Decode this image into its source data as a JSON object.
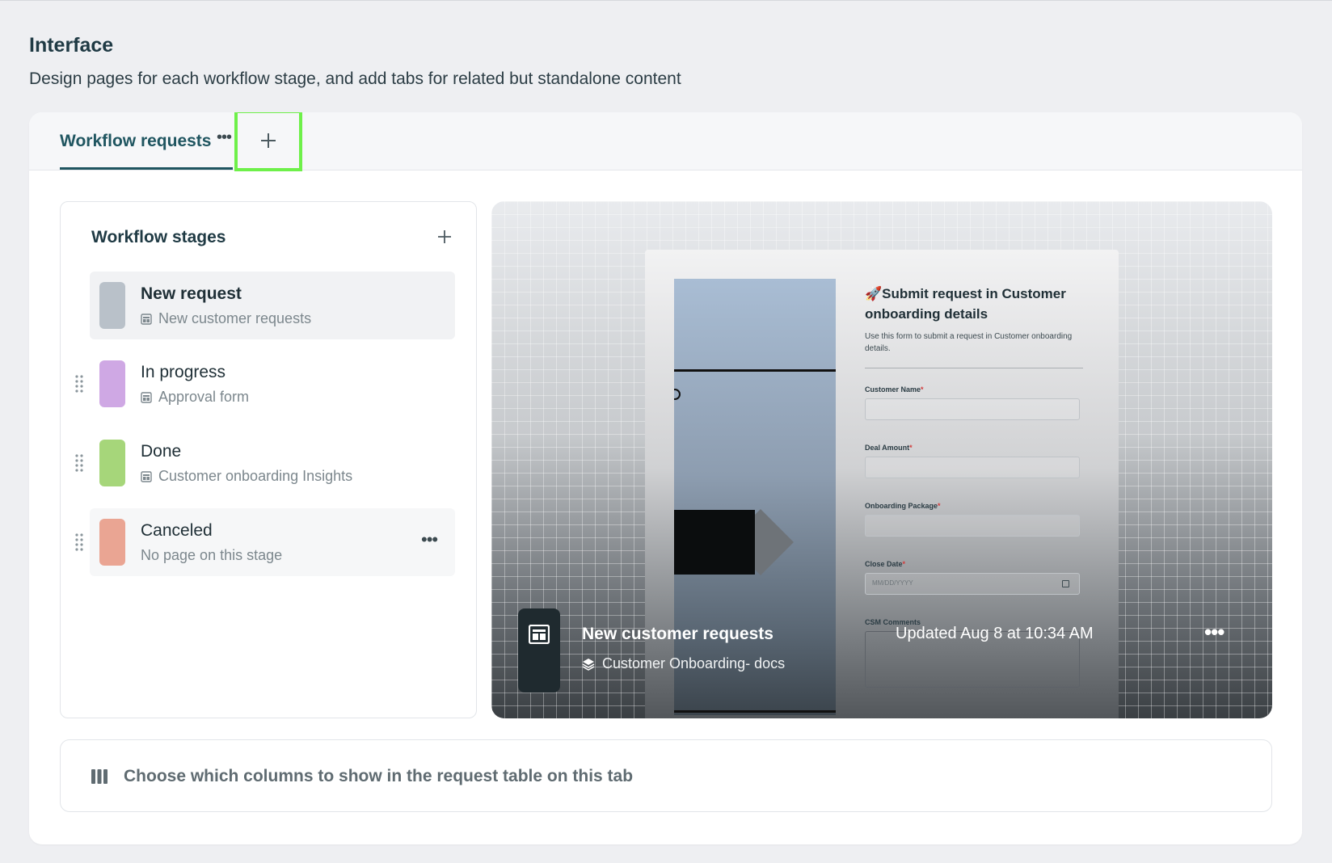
{
  "page": {
    "title": "Interface",
    "subtitle": "Design pages for each workflow stage, and add tabs for related but standalone content"
  },
  "tabs": {
    "items": [
      {
        "label": "Workflow requests",
        "active": true
      }
    ],
    "more_label": "•••",
    "add_icon": "plus-icon"
  },
  "stages": {
    "title": "Workflow stages",
    "add_icon": "plus-icon",
    "items": [
      {
        "name": "New request",
        "page": "New customer requests",
        "color": "#b9c1c9",
        "page_icon": "page-icon"
      },
      {
        "name": "In progress",
        "page": "Approval form",
        "color": "#cfa8e4",
        "page_icon": "page-icon"
      },
      {
        "name": "Done",
        "page": "Customer onboarding Insights",
        "color": "#a6d67a",
        "page_icon": "page-icon"
      },
      {
        "name": "Canceled",
        "page": "No page on this stage",
        "color": "#eaa593"
      }
    ],
    "more_label": "•••"
  },
  "preview": {
    "form_title": "🚀Submit request in Customer onboarding details",
    "form_desc": "Use this form to submit a request in Customer onboarding details.",
    "fields": [
      {
        "label": "Customer Name",
        "required": "*"
      },
      {
        "label": "Deal Amount",
        "required": "*"
      },
      {
        "label": "Onboarding Package",
        "required": "*"
      },
      {
        "label": "Close Date",
        "required": "*",
        "placeholder": "MM/DD/YYYY"
      },
      {
        "label": "CSM Comments"
      }
    ],
    "name": "New customer requests",
    "source": "Customer Onboarding- docs",
    "updated": "Updated Aug 8 at 10:34 AM",
    "more_label": "•••"
  },
  "columns_bar": {
    "label": "Choose which columns to show in the request table on this tab",
    "icon": "columns-icon"
  },
  "colors": {
    "accent": "#1f5560",
    "highlight": "#6ef04a"
  }
}
